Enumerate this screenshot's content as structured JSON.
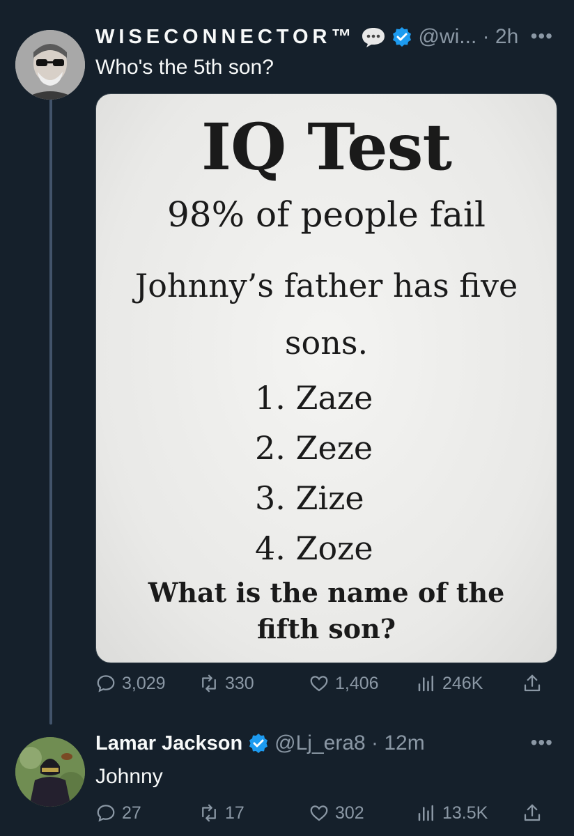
{
  "tweet": {
    "display_name": "WISECONNECTOR™",
    "handle_time": "@wi... · 2h",
    "text": "Who's the 5th son?",
    "more": "•••",
    "stats": {
      "replies": "3,029",
      "reposts": "330",
      "likes": "1,406",
      "views": "246K"
    },
    "media": {
      "title": "IQ Test",
      "subtitle": "98% of people fail",
      "question_line1": "Johnny’s father has five",
      "question_line2": "sons.",
      "sons": [
        "1. Zaze",
        "2. Zeze",
        "3. Zize",
        "4. Zoze"
      ],
      "ask_line1": "What is the name of the",
      "ask_line2": "fifth son?"
    }
  },
  "reply": {
    "display_name": "Lamar Jackson",
    "handle_time": "@Lj_era8 · 12m",
    "text": "Johnny",
    "more": "•••",
    "stats": {
      "replies": "27",
      "reposts": "17",
      "likes": "302",
      "views": "13.5K"
    }
  },
  "colors": {
    "background": "#15202b",
    "secondary_text": "#8b98a5",
    "verified": "#1d9bf0",
    "thread_line": "#42536a"
  }
}
